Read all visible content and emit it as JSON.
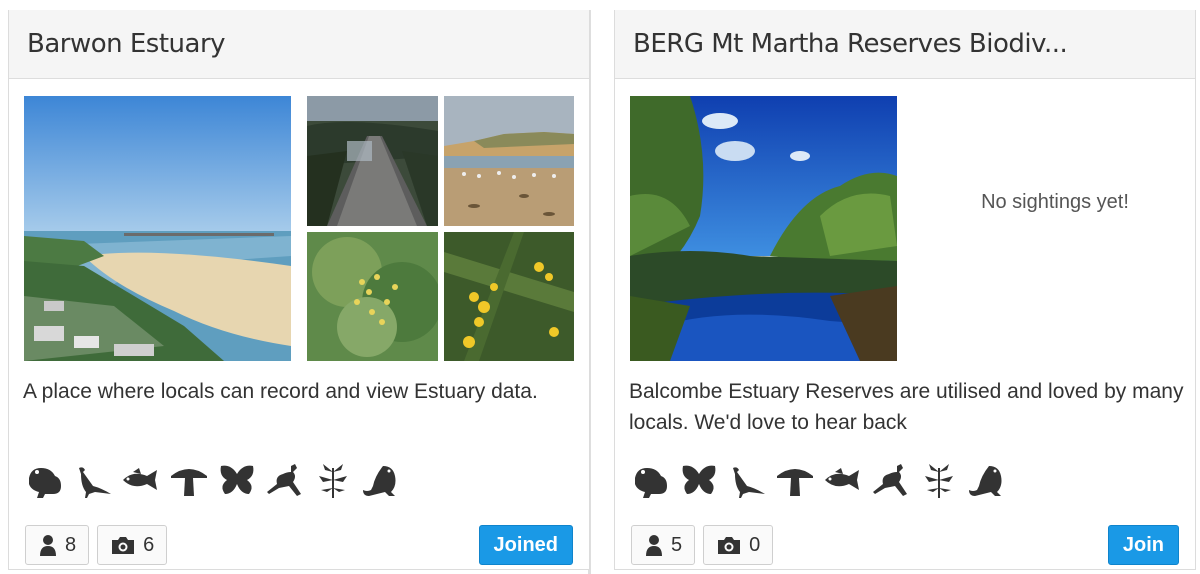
{
  "colors": {
    "button": "#1a99e6",
    "icon": "#333333",
    "header_bg": "#f5f5f5"
  },
  "projects": [
    {
      "title": "Barwon Estuary",
      "description": "A place where locals can record and view Estuary data.",
      "icons": [
        "frog-icon",
        "bird-icon",
        "fish-icon",
        "mushroom-icon",
        "butterfly-icon",
        "kangaroo-icon",
        "plant-icon",
        "lizard-icon"
      ],
      "members": "8",
      "photos": "6",
      "button_label": "Joined"
    },
    {
      "title": "BERG Mt Martha Reserves Biodiv...",
      "description": "Balcombe Estuary Reserves are utilised and loved by many locals. We'd love to hear back",
      "no_sightings": "No sightings yet!",
      "icons": [
        "frog-icon",
        "butterfly-icon",
        "bird-icon",
        "mushroom-icon",
        "fish-icon",
        "kangaroo-icon",
        "plant-icon",
        "lizard-icon"
      ],
      "members": "5",
      "photos": "0",
      "button_label": "Join"
    }
  ]
}
